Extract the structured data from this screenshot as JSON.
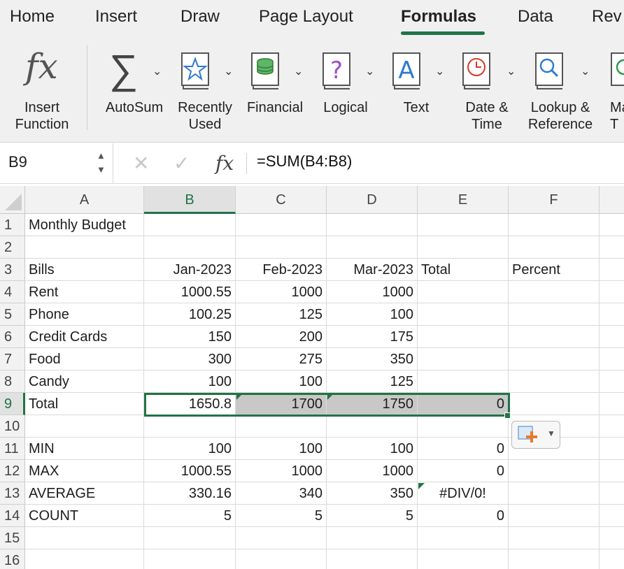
{
  "tabs": [
    {
      "label": "Home"
    },
    {
      "label": "Insert"
    },
    {
      "label": "Draw"
    },
    {
      "label": "Page Layout"
    },
    {
      "label": "Formulas",
      "active": true
    },
    {
      "label": "Data"
    },
    {
      "label": "Rev"
    }
  ],
  "ribbon": {
    "insert_function": {
      "label": "Insert\nFunction",
      "icon": "fx-icon"
    },
    "autosum": {
      "label": "AutoSum",
      "icon": "sigma-icon"
    },
    "recently_used": {
      "label": "Recently\nUsed",
      "icon": "star-book-icon"
    },
    "financial": {
      "label": "Financial",
      "icon": "coins-book-icon"
    },
    "logical": {
      "label": "Logical",
      "icon": "question-book-icon"
    },
    "text": {
      "label": "Text",
      "icon": "letter-a-book-icon"
    },
    "date_time": {
      "label": "Date &\nTime",
      "icon": "clock-book-icon"
    },
    "lookup": {
      "label": "Lookup &\nReference",
      "icon": "magnifier-book-icon"
    },
    "math": {
      "label": "Ma\nT",
      "icon": "math-book-icon"
    }
  },
  "formula_bar": {
    "name_box": "B9",
    "formula": "=SUM(B4:B8)",
    "cancel_icon": "x-icon",
    "enter_icon": "check-icon",
    "fx_label": "fx"
  },
  "sheet": {
    "columns": [
      "A",
      "B",
      "C",
      "D",
      "E",
      "F"
    ],
    "selected_column": "B",
    "selected_row": "9",
    "rows": [
      {
        "n": "1",
        "cells": [
          "Monthly Budget",
          "",
          "",
          "",
          "",
          ""
        ]
      },
      {
        "n": "2",
        "cells": [
          "",
          "",
          "",
          "",
          "",
          ""
        ]
      },
      {
        "n": "3",
        "cells": [
          "Bills",
          "Jan-2023",
          "Feb-2023",
          "Mar-2023",
          "Total",
          "Percent"
        ]
      },
      {
        "n": "4",
        "cells": [
          "Rent",
          "1000.55",
          "1000",
          "1000",
          "",
          ""
        ]
      },
      {
        "n": "5",
        "cells": [
          "Phone",
          "100.25",
          "125",
          "100",
          "",
          ""
        ]
      },
      {
        "n": "6",
        "cells": [
          "Credit Cards",
          "150",
          "200",
          "175",
          "",
          ""
        ]
      },
      {
        "n": "7",
        "cells": [
          "Food",
          "300",
          "275",
          "350",
          "",
          ""
        ]
      },
      {
        "n": "8",
        "cells": [
          "Candy",
          "100",
          "100",
          "125",
          "",
          ""
        ]
      },
      {
        "n": "9",
        "cells": [
          "Total",
          "1650.8",
          "1700",
          "1750",
          "0",
          ""
        ]
      },
      {
        "n": "10",
        "cells": [
          "",
          "",
          "",
          "",
          "",
          ""
        ]
      },
      {
        "n": "11",
        "cells": [
          "MIN",
          "100",
          "100",
          "100",
          "0",
          ""
        ]
      },
      {
        "n": "12",
        "cells": [
          "MAX",
          "1000.55",
          "1000",
          "1000",
          "0",
          ""
        ]
      },
      {
        "n": "13",
        "cells": [
          "AVERAGE",
          "330.16",
          "340",
          "350",
          "#DIV/0!",
          ""
        ]
      },
      {
        "n": "14",
        "cells": [
          "COUNT",
          "5",
          "5",
          "5",
          "0",
          ""
        ]
      },
      {
        "n": "15",
        "cells": [
          "",
          "",
          "",
          "",
          "",
          ""
        ]
      },
      {
        "n": "16",
        "cells": [
          "",
          "",
          "",
          "",
          "",
          ""
        ]
      }
    ]
  },
  "colors": {
    "accent": "#217346",
    "highlight": "#c8c8c8"
  }
}
